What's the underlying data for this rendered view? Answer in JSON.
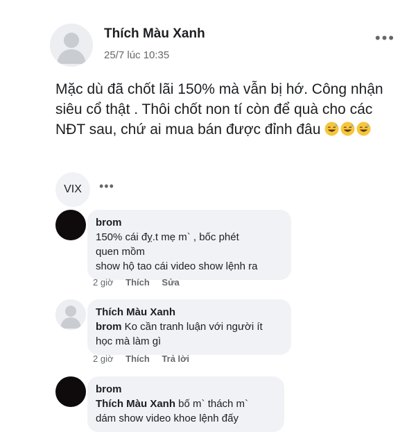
{
  "post": {
    "author": "Thích Màu Xanh",
    "time": "25/7 lúc 10:35",
    "text": "Mặc dù đã chốt lãi 150% mà vẫn bị hớ. Công nhận siêu cổ thật . Thôi chốt non tí còn để quà cho các NĐT sau, chứ ai mua bán được đỉnh đâu",
    "more_label": "•••",
    "emoji_icon": "grinning-sweat-emoji"
  },
  "chip": {
    "label": "VIX",
    "more_label": "•••"
  },
  "comments": [
    {
      "author": "brom",
      "lines": [
        "150% cái  đỵ.t  mẹ m` , bốc phét",
        "quen mồm",
        "show hộ tao cái video show lệnh ra"
      ],
      "time": "2 giờ",
      "action1": "Thích",
      "action2": "Sửa"
    },
    {
      "author": "Thích Màu Xanh",
      "mention": "brom",
      "lines": [
        " Ko cần tranh luận với người ít",
        "học mà làm gì"
      ],
      "time": "2 giờ",
      "action1": "Thích",
      "action2": "Trả lời"
    },
    {
      "author": "brom",
      "mention": "Thích Màu Xanh",
      "lines": [
        "  bố m` thách m`",
        "dám show video khoe lệnh đấy"
      ]
    }
  ],
  "colors": {
    "bubble": "#f0f2f5",
    "secondary_text": "#65676b",
    "text": "#1c1e21"
  }
}
